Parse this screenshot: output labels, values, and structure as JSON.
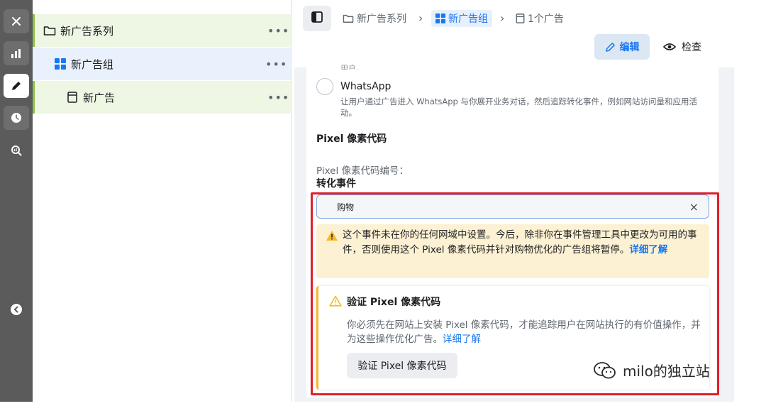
{
  "rail": {
    "items": [
      {
        "icon": "close-icon"
      },
      {
        "icon": "bar-chart-icon"
      },
      {
        "icon": "pencil-icon"
      },
      {
        "icon": "clock-icon"
      },
      {
        "icon": "search-chart-icon"
      },
      {
        "icon": "chevron-left-icon"
      }
    ]
  },
  "tree": {
    "campaign": {
      "label": "新广告系列",
      "more": "•••"
    },
    "adset": {
      "label": "新广告组",
      "more": "•••"
    },
    "ad": {
      "label": "新广告",
      "more": "•••"
    }
  },
  "breadcrumb": {
    "campaign": "新广告系列",
    "adset": "新广告组",
    "ad": "1个广告",
    "separator": "›"
  },
  "actions": {
    "edit": "编辑",
    "inspect": "检查"
  },
  "form": {
    "cut_text": "用户。",
    "whatsapp_label": "WhatsApp",
    "whatsapp_desc": "让用户通过广告进入 WhatsApp 与你展开业务对话，然后追踪转化事件，例如网站访问量和应用活动。",
    "pixel_section_title": "Pixel 像素代码",
    "pixel_id_label": "Pixel 像素代码编号：",
    "conversion_title": "转化事件",
    "conversion_value": "购物",
    "clear_symbol": "×"
  },
  "warning": {
    "text": "这个事件未在你的任何网域中设置。今后，除非你在事件管理工具中更改为可用的事件，否则使用这个 Pixel 像素代码并针对购物优化的广告组将暂停。",
    "link": "详细了解"
  },
  "verify": {
    "title": "验证 Pixel 像素代码",
    "text": "你必须先在网站上安装 Pixel 像素代码，才能追踪用户在网站执行的有价值操作，并为这些操作优化广告。",
    "link": "详细了解",
    "button": "验证 Pixel 像素代码"
  },
  "watermark": {
    "text": "milo的独立站"
  },
  "colors": {
    "accent": "#1877f2",
    "warning_bg": "#fdf1d3",
    "warning_icon": "#f7b928",
    "highlight_frame": "#e0202a"
  }
}
